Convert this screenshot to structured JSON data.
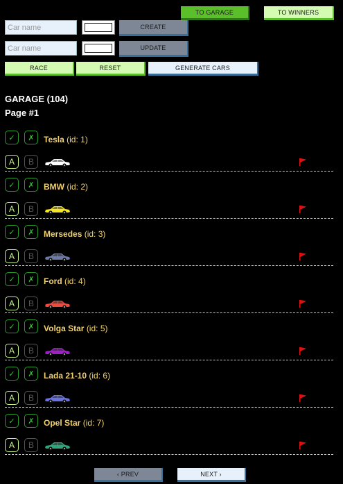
{
  "nav": {
    "garage_label": "TO GARAGE",
    "winners_label": "TO WINNERS"
  },
  "create": {
    "placeholder": "Car name",
    "color": "#ffffff",
    "button_label": "CREATE"
  },
  "update": {
    "placeholder": "Car name",
    "color": "#ffffff",
    "button_label": "UPDATE"
  },
  "controls": {
    "race_label": "RACE",
    "reset_label": "RESET",
    "generate_label": "GENERATE CARS"
  },
  "garage": {
    "title": "GARAGE (104)",
    "page": "Page #1"
  },
  "cars": [
    {
      "name": "Tesla",
      "id_text": "(id: 1)",
      "color": "#ffffff"
    },
    {
      "name": "BMW",
      "id_text": "(id: 2)",
      "color": "#f5e625"
    },
    {
      "name": "Mersedes",
      "id_text": "(id: 3)",
      "color": "#6c7aa6"
    },
    {
      "name": "Ford",
      "id_text": "(id: 4)",
      "color": "#f04a3e"
    },
    {
      "name": "Volga Star",
      "id_text": "(id: 5)",
      "color": "#a020c8"
    },
    {
      "name": "Lada 21-10",
      "id_text": "(id: 6)",
      "color": "#6a72e0"
    },
    {
      "name": "Opel Star",
      "id_text": "(id: 7)",
      "color": "#2fa57a"
    }
  ],
  "track_buttons": {
    "select_glyph": "✓",
    "remove_glyph": "✗",
    "start_label": "A",
    "stop_label": "B"
  },
  "icons": {
    "select": "check-icon",
    "remove": "cross-icon",
    "car": "car-icon",
    "finish": "finish-flag-icon"
  },
  "colors": {
    "flag": "#e01010",
    "car_name": "#f3d26b"
  },
  "pagination": {
    "prev_label": "‹ PREV",
    "next_label": "NEXT ›"
  }
}
